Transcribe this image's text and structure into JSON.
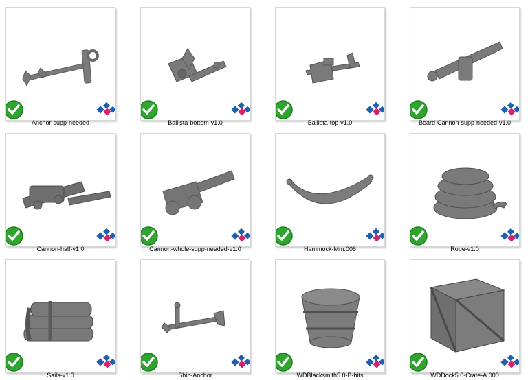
{
  "files": [
    {
      "name": "Anchor-supp-needed",
      "model": "anchor-model",
      "status_icon": "check-icon",
      "app_icon": "slicer-logo-icon"
    },
    {
      "name": "Ballista-bottom-v1.0",
      "model": "ballista-bottom-model",
      "status_icon": "check-icon",
      "app_icon": "slicer-logo-icon"
    },
    {
      "name": "Ballista-top-v1.0",
      "model": "ballista-top-model",
      "status_icon": "check-icon",
      "app_icon": "slicer-logo-icon"
    },
    {
      "name": "Board-Cannon-supp-needed-v1.0",
      "model": "board-cannon-model",
      "status_icon": "check-icon",
      "app_icon": "slicer-logo-icon"
    },
    {
      "name": "Cannon-half-v1.0",
      "model": "cannon-half-model",
      "status_icon": "check-icon",
      "app_icon": "slicer-logo-icon"
    },
    {
      "name": "Cannon-whole-supp-needed-v1.0",
      "model": "cannon-whole-model",
      "status_icon": "check-icon",
      "app_icon": "slicer-logo-icon"
    },
    {
      "name": "Hammock-Mm.006",
      "model": "hammock-model",
      "status_icon": "check-icon",
      "app_icon": "slicer-logo-icon"
    },
    {
      "name": "Rope-v1.0",
      "model": "rope-model",
      "status_icon": "check-icon",
      "app_icon": "slicer-logo-icon"
    },
    {
      "name": "Sails-v1.0",
      "model": "sails-model",
      "status_icon": "check-icon",
      "app_icon": "slicer-logo-icon"
    },
    {
      "name": "Ship-Anchor",
      "model": "ship-anchor-model",
      "status_icon": "check-icon",
      "app_icon": "slicer-logo-icon"
    },
    {
      "name": "WDBlacksmith5.0-B-bits",
      "model": "bucket-model",
      "status_icon": "check-icon",
      "app_icon": "slicer-logo-icon"
    },
    {
      "name": "WDDock5.0-Crate-A.000",
      "model": "crate-model",
      "status_icon": "check-icon",
      "app_icon": "slicer-logo-icon"
    }
  ],
  "colors": {
    "check_green": "#2fa52f",
    "model_gray": "#7c7c7c",
    "logo_blue": "#1f5fb0",
    "logo_pink": "#d8206c"
  }
}
